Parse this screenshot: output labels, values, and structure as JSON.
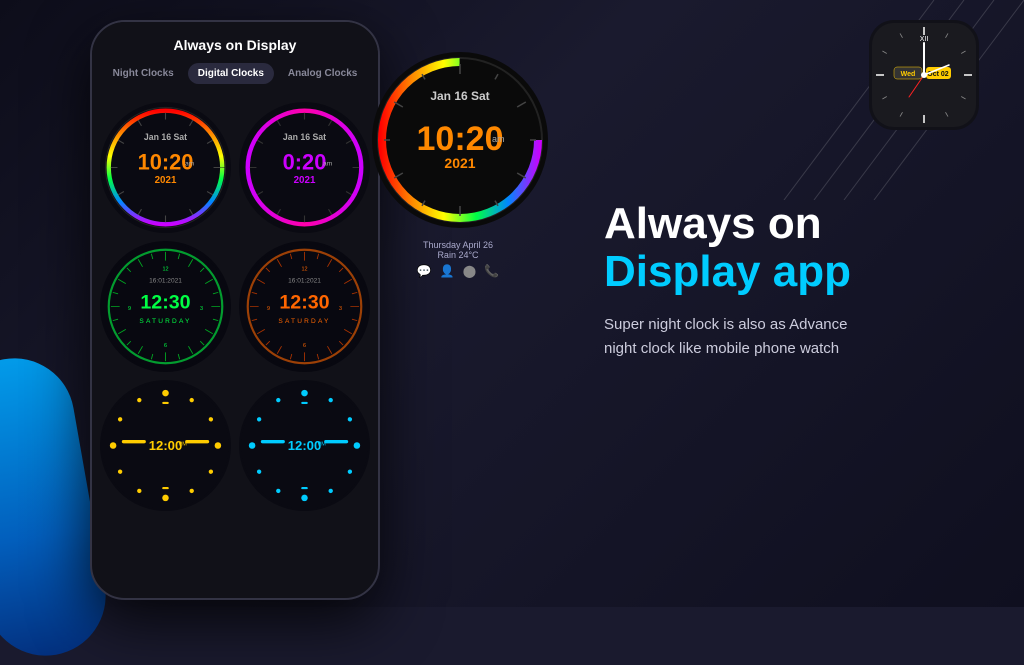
{
  "background": {
    "primary": "#0d0d1a",
    "secondary": "#1a1a2e"
  },
  "header": {
    "title": "Always on Display"
  },
  "tabs": [
    {
      "label": "Night Clocks",
      "active": false
    },
    {
      "label": "Digital Clocks",
      "active": true
    },
    {
      "label": "Analog Clocks",
      "active": false
    }
  ],
  "clocks": {
    "row1": [
      {
        "date": "Jan 16 Sat",
        "time": "10:20",
        "ampm": "am",
        "year": "2021",
        "color": "#ff8800",
        "ringColor": "conic-gradient(from 0deg, #ff0000, #ff8800, #ffff00, #00ff00, #0088ff, #8800ff, #ff0000)"
      },
      {
        "date": "Jan 16 Sat",
        "time": "0:20",
        "ampm": "am",
        "year": "2021",
        "color": "#cc00ff",
        "ringColor": "conic-gradient(from 0deg, #cc00ff, #8800ff, #4400cc, #cc00ff)"
      }
    ],
    "row2": [
      {
        "date": "16:01:2021",
        "time": "12:30",
        "day": "SATURDAY",
        "color": "#00ff44",
        "ringColor": "#00ff44"
      },
      {
        "date": "16:01:2021",
        "time": "12:30",
        "day": "SATURDAY",
        "color": "#ff6600",
        "ringColor": "conic-gradient(from 0deg, #ff6600, #ff3300, #ff6600)"
      }
    ],
    "row3": [
      {
        "time": "12:00",
        "ampm": "PM",
        "color": "#ffcc00",
        "dotColor": "#ffcc00"
      },
      {
        "time": "12:00",
        "ampm": "PM",
        "color": "#00ccff",
        "dotColor": "#00ccff"
      }
    ]
  },
  "large_clock": {
    "date": "Jan 16 Sat",
    "time": "10:20",
    "ampm": "am",
    "year": "2021",
    "mainColor": "#ff8800",
    "ringGradient": "conic-gradient(from -90deg, #ff0000 0%, #ff8800 15%, #ffff00 30%, #00ff00 50%, #0088ff 70%, #8800ff 85%, #ff0000 100%)"
  },
  "phone_info": {
    "date": "Thursday April 26",
    "weather": "Rain 24°C"
  },
  "watch_face": {
    "day": "Wed",
    "date": "Oct",
    "number": "02"
  },
  "app_info": {
    "title_line1": "Always on",
    "title_line2": "Display app",
    "description": "Super night clock is also as Advance\nnight clock like mobile phone watch",
    "accent_color": "#00ccff"
  }
}
